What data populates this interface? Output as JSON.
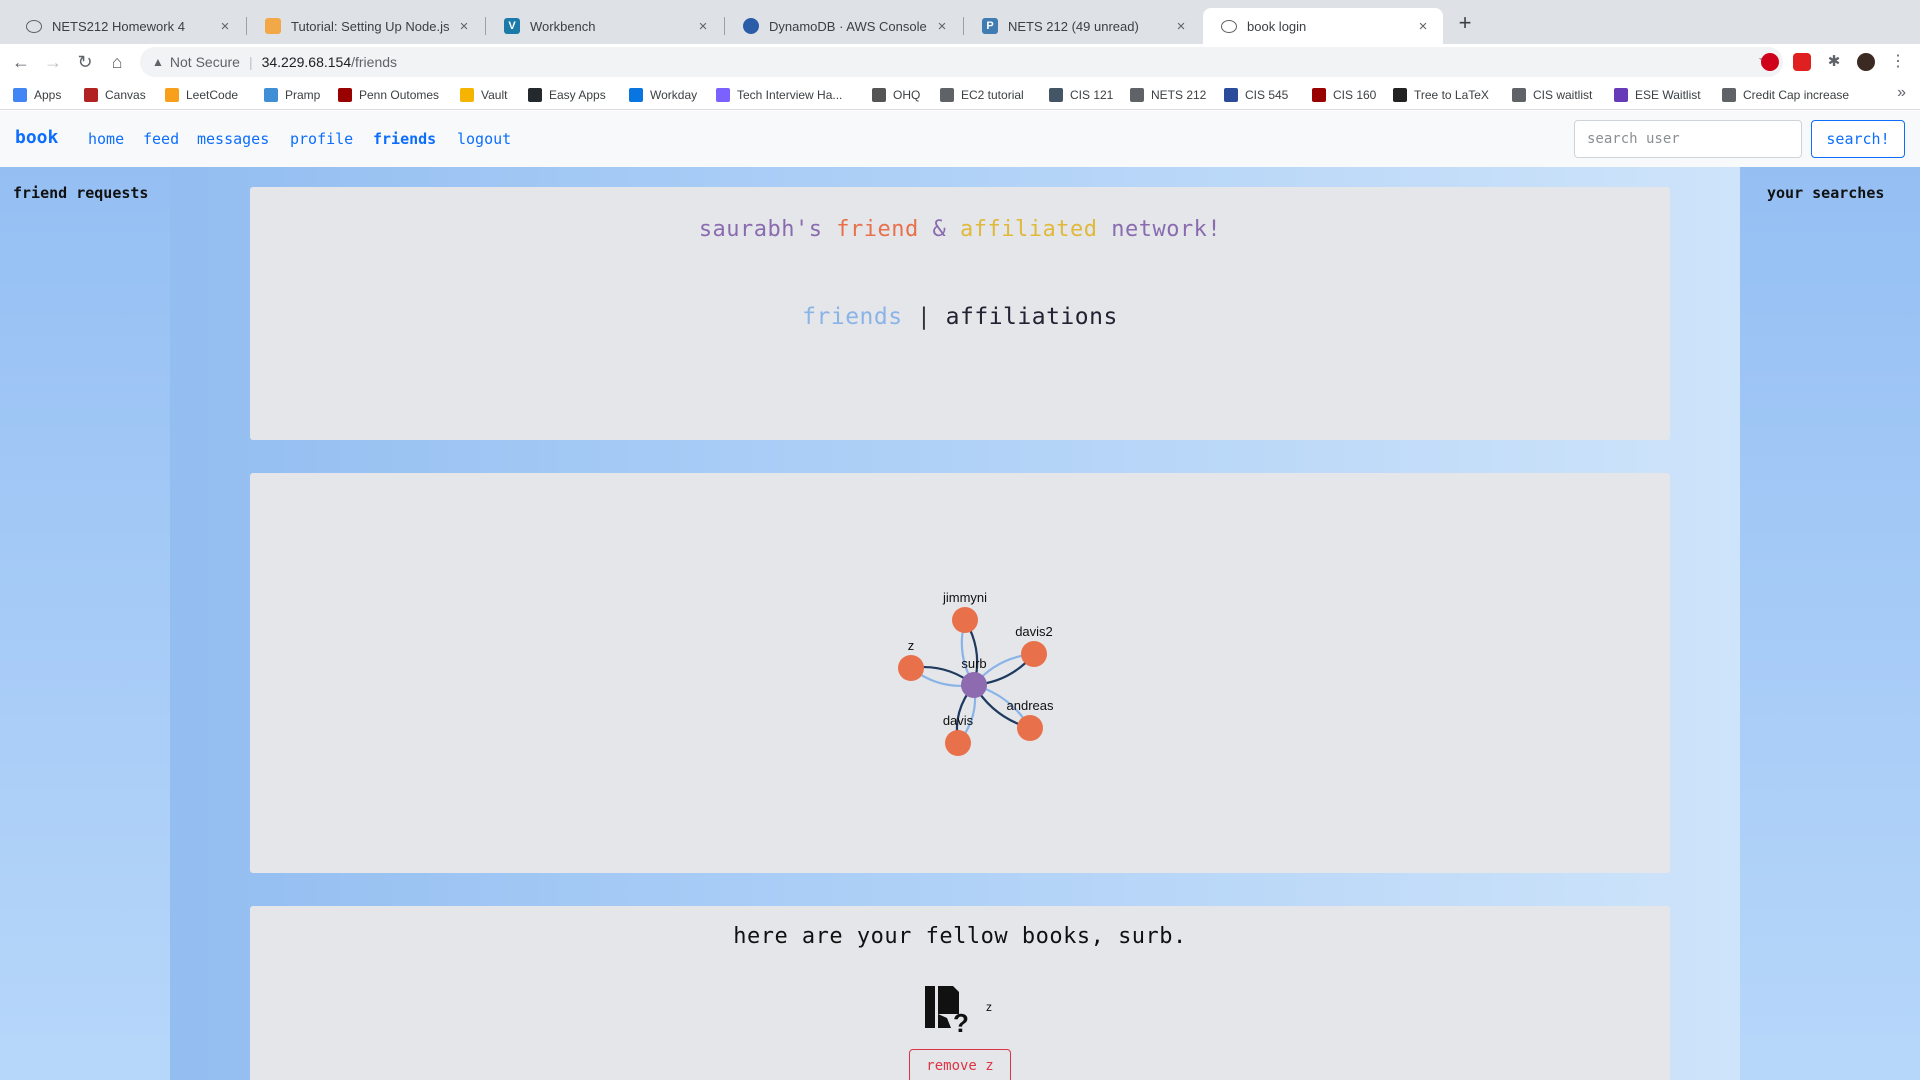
{
  "browser": {
    "tabs": [
      {
        "title": "NETS212 Homework 4",
        "icon": "globe-icon",
        "color": "#5f6368"
      },
      {
        "title": "Tutorial: Setting Up Node.js on",
        "icon": "aws-box-icon",
        "color": "#f3a847"
      },
      {
        "title": "Workbench",
        "icon": "vocareum-icon",
        "color": "#1c7aa8"
      },
      {
        "title": "DynamoDB · AWS Console",
        "icon": "dynamodb-icon",
        "color": "#2a5ca8"
      },
      {
        "title": "NETS 212 (49 unread)",
        "icon": "piazza-icon",
        "color": "#3e7cb1"
      },
      {
        "title": "book login",
        "icon": "globe-icon",
        "color": "#5f6368"
      }
    ],
    "security": "Not Secure",
    "url_host": "34.229.68.154",
    "url_path": "/friends",
    "bookmarks": [
      {
        "label": "Apps",
        "icon": "apps-grid-icon",
        "color": "#4285f4"
      },
      {
        "label": "Canvas",
        "icon": "canvas-icon",
        "color": "#b22222"
      },
      {
        "label": "LeetCode",
        "icon": "leetcode-icon",
        "color": "#f89f1b"
      },
      {
        "label": "Pramp",
        "icon": "pramp-icon",
        "color": "#3f8ed6"
      },
      {
        "label": "Penn Outomes",
        "icon": "penn-icon",
        "color": "#990000"
      },
      {
        "label": "Vault",
        "icon": "vault-icon",
        "color": "#f4b400"
      },
      {
        "label": "Easy Apps",
        "icon": "github-icon",
        "color": "#24292e"
      },
      {
        "label": "Workday",
        "icon": "workday-icon",
        "color": "#0875e1"
      },
      {
        "label": "Tech Interview Ha...",
        "icon": "code-icon",
        "color": "#7b61ff"
      },
      {
        "label": "OHQ",
        "icon": "ohq-icon",
        "color": "#555555"
      },
      {
        "label": "EC2 tutorial",
        "icon": "globe-icon",
        "color": "#5f6368"
      },
      {
        "label": "CIS 121",
        "icon": "cis121-icon",
        "color": "#445566"
      },
      {
        "label": "NETS 212",
        "icon": "globe-icon",
        "color": "#5f6368"
      },
      {
        "label": "CIS 545",
        "icon": "cis545-icon",
        "color": "#2b4c9b"
      },
      {
        "label": "CIS 160",
        "icon": "penn-icon",
        "color": "#990000"
      },
      {
        "label": "Tree to LaTeX",
        "icon": "latex-icon",
        "color": "#222222"
      },
      {
        "label": "CIS waitlist",
        "icon": "globe-icon",
        "color": "#5f6368"
      },
      {
        "label": "ESE Waitlist",
        "icon": "forms-icon",
        "color": "#673ab7"
      },
      {
        "label": "Credit Cap increase",
        "icon": "globe-icon",
        "color": "#5f6368"
      }
    ]
  },
  "site": {
    "brand": "book",
    "nav": [
      "home",
      "feed",
      "messages",
      "profile",
      "friends",
      "logout"
    ],
    "active_nav": "friends",
    "search_placeholder": "search user",
    "search_button": "search!",
    "accent": "#0d6efd"
  },
  "sidebar_left": {
    "title": "friend requests"
  },
  "sidebar_right": {
    "title": "your searches"
  },
  "network": {
    "title_parts": [
      {
        "text": "saurabh's",
        "color": "#8a6bb0"
      },
      {
        "text": " ",
        "color": "#8a6bb0"
      },
      {
        "text": "friend",
        "color": "#e8704a"
      },
      {
        "text": " & ",
        "color": "#8a6bb0"
      },
      {
        "text": "affiliated",
        "color": "#e0b93a"
      },
      {
        "text": " network!",
        "color": "#8a6bb0"
      }
    ],
    "toggle_friends": "friends",
    "toggle_sep": " | ",
    "toggle_affiliations": "affiliations"
  },
  "graph": {
    "center": {
      "label": "surb",
      "color": "#8e6ab0"
    },
    "friend_color": "#e8704a",
    "friends": [
      "jimmyni",
      "davis2",
      "z",
      "andreas",
      "davis"
    ]
  },
  "fellows": {
    "heading": "here are your fellow books, surb.",
    "friends": [
      {
        "name": "z",
        "remove_label": "remove z"
      }
    ],
    "danger": "#dc3545"
  }
}
